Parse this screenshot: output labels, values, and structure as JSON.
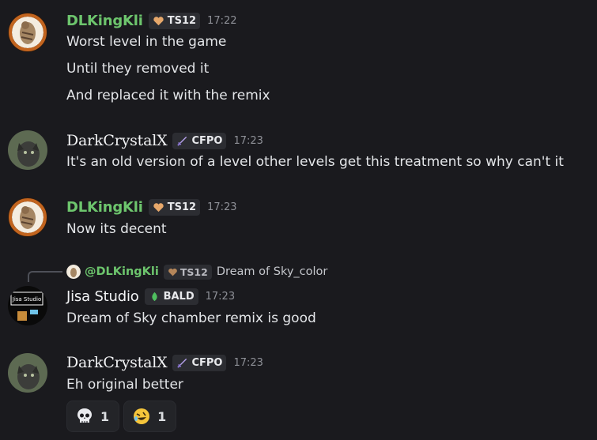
{
  "messages": [
    {
      "user": "DLKingKli",
      "tag": "TS12",
      "time": "17:22",
      "lines": [
        "Worst level in the game",
        "Until they removed it",
        "And replaced it with the remix"
      ]
    },
    {
      "user": "DarkCrystalX",
      "tag": "CFPO",
      "time": "17:23",
      "lines": [
        "It's an old version of a level other levels get this treatment so why can't it"
      ]
    },
    {
      "user": "DLKingKli",
      "tag": "TS12",
      "time": "17:23",
      "lines": [
        "Now its decent"
      ]
    },
    {
      "reply": {
        "user": "@DLKingKli",
        "tag": "TS12",
        "text": "Dream of Sky_color"
      },
      "user": "Jisa Studio",
      "tag": "BALD",
      "time": "17:23",
      "avatar_text": "Jisa Studio",
      "lines": [
        "Dream of Sky chamber remix is good"
      ]
    },
    {
      "user": "DarkCrystalX",
      "tag": "CFPO",
      "time": "17:23",
      "lines": [
        "Eh original better"
      ]
    }
  ],
  "reactions": [
    {
      "emoji": "skull-emoji",
      "count": "1"
    },
    {
      "emoji": "rofl-emoji",
      "count": "1"
    }
  ],
  "colors": {
    "background": "#1a1a1e",
    "username_green": "#6dc56d",
    "timestamp": "#8e9097"
  }
}
